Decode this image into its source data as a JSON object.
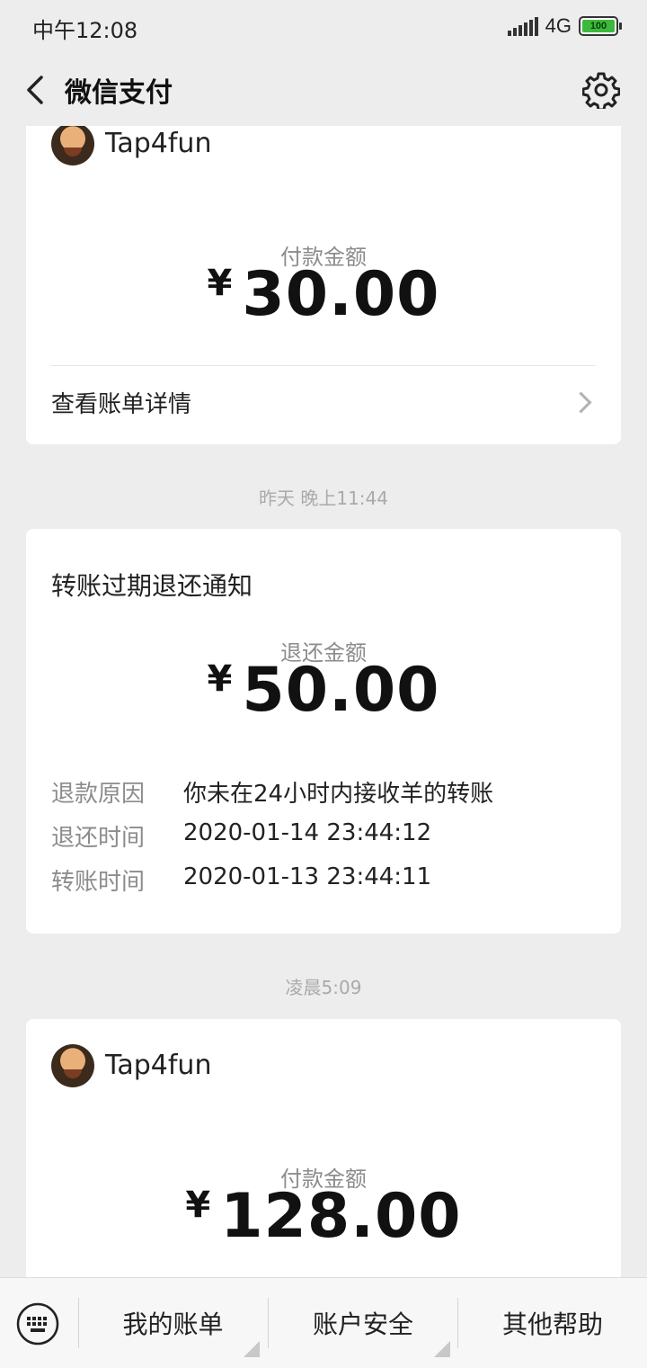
{
  "status_bar": {
    "time": "中午12:08",
    "network": "4G",
    "battery": "100"
  },
  "nav": {
    "title": "微信支付"
  },
  "cards": [
    {
      "merchant": "Tap4fun",
      "amount_label": "付款金额",
      "currency": "¥",
      "amount": "30.00",
      "link_label": "查看账单详情"
    },
    {
      "timestamp": "昨天 晚上11:44",
      "title": "转账过期退还通知",
      "amount_label": "退还金额",
      "currency": "¥",
      "amount": "50.00",
      "details": [
        {
          "key": "退款原因",
          "value": "你未在24小时内接收羊的转账"
        },
        {
          "key": "退还时间",
          "value": "2020-01-14 23:44:12"
        },
        {
          "key": "转账时间",
          "value": "2020-01-13 23:44:11"
        }
      ]
    },
    {
      "timestamp": "凌晨5:09",
      "merchant": "Tap4fun",
      "amount_label": "付款金额",
      "currency": "¥",
      "amount": "128.00"
    }
  ],
  "bottom_menu": {
    "items": [
      "我的账单",
      "账户安全",
      "其他帮助"
    ]
  }
}
